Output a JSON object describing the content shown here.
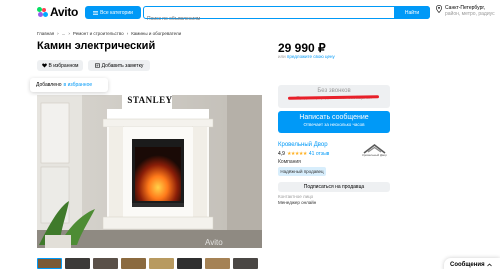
{
  "header": {
    "logo_text": "Avito",
    "categories_label": "Все категории",
    "search_placeholder": "Поиск по объявлениям",
    "search_button": "Найти",
    "location_line1": "Санкт-Петербург,",
    "location_line2": "район, метро, радиус"
  },
  "breadcrumbs": [
    "Главная",
    "›",
    "...",
    "›",
    "Ремонт и строительство",
    "›",
    "Камины и обогреватели"
  ],
  "listing": {
    "title": "Камин электрический",
    "favorite_label": "В избранном",
    "note_label": "Добавить заметку",
    "toast_prefix": "Добавлено",
    "toast_link": "в избранное",
    "photo_caption": "STANLEY",
    "watermark": "Avito"
  },
  "price": {
    "value": "29 990 ₽",
    "sub_prefix": "или",
    "sub_link": "предложите свою цену"
  },
  "contact": {
    "no_calls_title": "Без звонков",
    "no_calls_sub": "Продавец предпочитает сообщения",
    "message_button": "Написать сообщение",
    "message_sub": "Отвечает за несколько часов"
  },
  "seller": {
    "name": "Кровельный Двор",
    "rating": "4,9",
    "stars": "★★★★★",
    "reviews": "41 отзыв",
    "type": "Компания",
    "badge": "Надёжный продавец",
    "logo_text": "Кровельный Двор",
    "subscribe": "Подписаться на продавца",
    "contact_label": "Контактное лицо",
    "contact_name": "Менеджер онлайн"
  },
  "chat": {
    "label": "Сообщения"
  },
  "colors": {
    "accent": "#0099f7",
    "no_calls_strike": "#e8202a",
    "star": "#ffb021"
  }
}
